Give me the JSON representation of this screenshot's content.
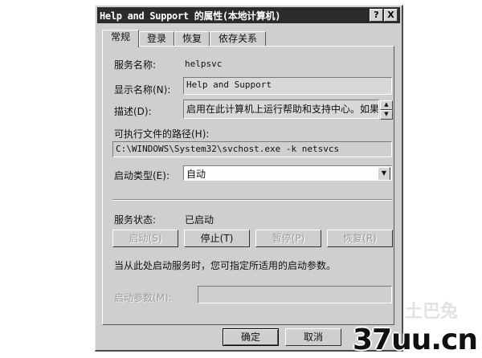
{
  "window": {
    "title": "Help and Support 的属性(本地计算机)",
    "help_glyph": "?",
    "close_glyph": "X"
  },
  "tabs": [
    {
      "label": "常规",
      "active": true
    },
    {
      "label": "登录",
      "active": false
    },
    {
      "label": "恢复",
      "active": false
    },
    {
      "label": "依存关系",
      "active": false
    }
  ],
  "general": {
    "service_name_label": "服务名称:",
    "service_name_value": "helpsvc",
    "display_name_label": "显示名称(N):",
    "display_name_value": "Help and Support",
    "description_label": "描述(D):",
    "description_value": "启用在此计算机上运行帮助和支持中心。如果",
    "exe_path_label": "可执行文件的路径(H):",
    "exe_path_value": "C:\\WINDOWS\\System32\\svchost.exe -k netsvcs",
    "startup_type_label": "启动类型(E):",
    "startup_type_value": "自动",
    "status_label": "服务状态:",
    "status_value": "已启动",
    "buttons": {
      "start": "启动(S)",
      "stop": "停止(T)",
      "pause": "暂停(P)",
      "resume": "恢复(R)"
    },
    "hint_text": "当从此处启动服务时，您可指定所适用的启动参数。",
    "start_params_label": "启动参数(M):",
    "start_params_value": ""
  },
  "footer": {
    "ok": "确定",
    "cancel": "取消"
  },
  "watermark": {
    "text": "37uu.cn",
    "faint_text": "土巴兔"
  }
}
